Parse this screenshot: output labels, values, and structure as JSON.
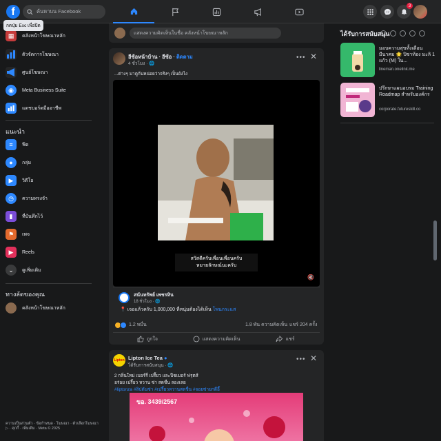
{
  "topbar": {
    "logo": "f",
    "search_placeholder": "ค้นหาบน Facebook",
    "tooltip": "กดปุ่ม Esc เพื่อปิด",
    "notification_count": "3",
    "nav_icons": [
      "home-icon",
      "flag-icon",
      "chart-icon",
      "megaphone-icon",
      "play-icon"
    ]
  },
  "sidebar": {
    "top_items": [
      {
        "label": "คลังหน้าโฆษณาหลัก",
        "icon": "tile-icon"
      },
      {
        "label": "คลังโฆษณา",
        "icon": "book-icon"
      },
      {
        "label": "ตัวจัดการโฆษณา",
        "icon": "bar-chart-icon"
      },
      {
        "label": "ศูนย์โฆษณา",
        "icon": "megaphone-icon"
      },
      {
        "label": "Meta Business Suite",
        "icon": "meta-icon"
      },
      {
        "label": "แดชบอร์ดมืออาชีพ",
        "icon": "dashboard-icon"
      }
    ],
    "recommend_title": "แนะนำ",
    "recommend_items": [
      {
        "label": "ฟีด",
        "icon": "feed-icon"
      },
      {
        "label": "กลุ่ม",
        "icon": "groups-icon"
      },
      {
        "label": "วิดีโอ",
        "icon": "video-icon"
      },
      {
        "label": "ความทรงจำ",
        "icon": "memories-icon"
      },
      {
        "label": "ที่บันทึกไว้",
        "icon": "saved-icon"
      },
      {
        "label": "เพจ",
        "icon": "pages-icon"
      },
      {
        "label": "Reels",
        "icon": "reels-icon"
      },
      {
        "label": "ดูเพิ่มเติม",
        "icon": "chevron-down-icon"
      }
    ],
    "shortcuts_title": "ทางลัดของคุณ",
    "shortcuts": [
      {
        "label": "คลังหน้าโฆษณาหลัก"
      }
    ],
    "footer": "ความเป็นส่วนตัว · ข้อกำหนด · โฆษณา · ตัวเลือกโฆษณา ▷ · คุกกี้ · เพิ่มเติม · Meta © 2025"
  },
  "composer": {
    "placeholder": "แสดงความคิดเห็นในชื่อ คลังหน้าโฆษณาหลัก"
  },
  "post": {
    "author": "อีซ้อหน้าบ้าน · อีซ้อ",
    "follow": "ติดตาม",
    "time": "4 ชั่วโมง · ",
    "text": "...ต่างๆ มาดูกันหน่อยว่าจริงๆ เป็นยังไง",
    "video_caption_1": "สวัสดีครับเพื่อนเพื่อนครับ",
    "video_caption_2": "หมายลักษณ์นะครับ",
    "video_author": "สนันทรัพย์ เพชรหิน",
    "video_time": "18 ชั่วโมง · ",
    "video_text": "เจอแล้วครับ 1,000,000 ที่หนุ่มต้องได้เห็น",
    "video_link": "โพนกระแส",
    "reactions": "1.2 หมื่น",
    "comments": "1.8 พัน ความคิดเห็น",
    "shares": "แชร์ 204 ครั้ง",
    "like": "ถูกใจ",
    "comment": "แสดงความคิดเห็น",
    "share": "แชร์"
  },
  "ad_post": {
    "logo": "Lipton",
    "author": "Lipton Ice Tea",
    "sponsored": "ได้รับการสนับสนุน · ",
    "line1": "2 กลิ่นใหม่ เบอร์รี่ เปรี้ยว และปีชเมอร์ ฟรุตส์",
    "line2": "อร่อย เปรี้ยว หวาน ซ่า สดชื่น ลองเลย",
    "hashtags": "#liptonza #ลิปตันซ่า #เปรี้ยวหวานสดชื่น #จอยซ่ายกดีอี้",
    "image_code": "ขอ. 3439/2567"
  },
  "right_column": {
    "title": "ได้รับการสนับสนุน",
    "ads": [
      {
        "title": "มอบความสุขทั้งเดือน มีนาคม 🌟 ปิซาท้อง มะลิ 1 แก้ว (M) ใน...",
        "url": "lineman.onelink.me",
        "color": "#35b96b"
      },
      {
        "title": "ปรึกษาแผนอบรม Training Roadmap สำหรับองค์กร",
        "url": "corporate.futureskill.co",
        "color": "#f1b5d4"
      }
    ]
  }
}
